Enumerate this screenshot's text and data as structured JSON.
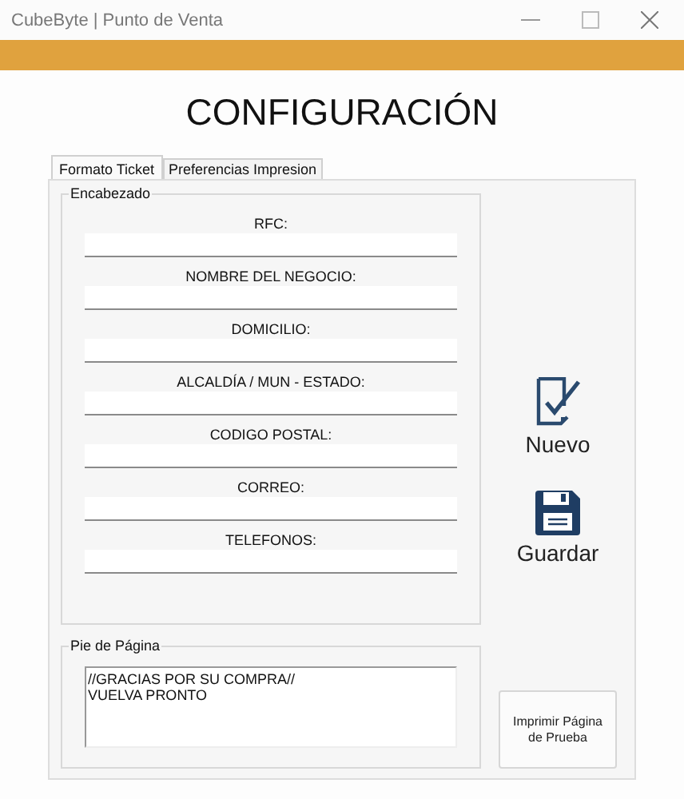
{
  "window": {
    "title": "CubeByte | Punto de Venta"
  },
  "heading": "CONFIGURACIÓN",
  "tabs": [
    {
      "label": "Formato Ticket",
      "selected": true
    },
    {
      "label": "Preferencias Impresion",
      "selected": false
    }
  ],
  "header_group": {
    "title": "Encabezado",
    "fields": [
      {
        "label": "RFC:"
      },
      {
        "label": "NOMBRE DEL NEGOCIO:"
      },
      {
        "label": "DOMICILIO:"
      },
      {
        "label": "ALCALDÍA / MUN - ESTADO:"
      },
      {
        "label": "CODIGO POSTAL:"
      },
      {
        "label": "CORREO:"
      },
      {
        "label": "TELEFONOS:"
      }
    ]
  },
  "actions": [
    {
      "label": "Nuevo",
      "kind": "new"
    },
    {
      "label": "Guardar",
      "kind": "save"
    }
  ],
  "footer_group": {
    "title": "Pie de Página",
    "lines": [
      "//GRACIAS POR SU COMPRA//",
      "VUELVA PRONTO"
    ]
  },
  "print_button": "Imprimir Página de Prueba"
}
